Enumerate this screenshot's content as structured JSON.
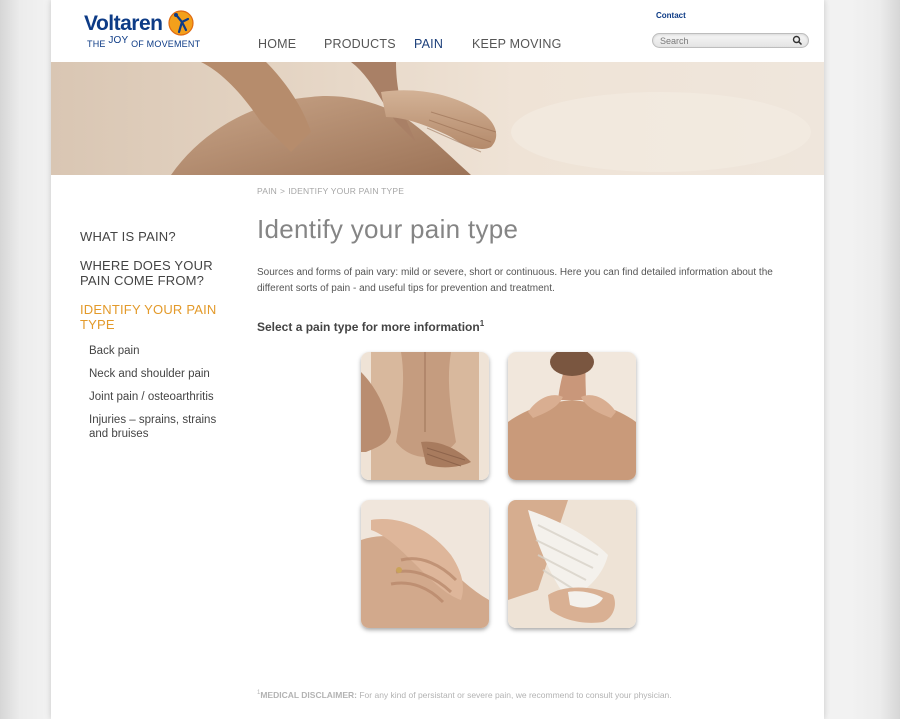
{
  "header": {
    "logo_text": "Voltaren",
    "logo_tagline_the": "THE",
    "logo_tagline_joy": "JOY",
    "logo_tagline_rest": "OF MOVEMENT",
    "contact_label": "Contact",
    "search_placeholder": "Search",
    "brand_color": "#0d3b86",
    "accent_color": "#e39a2a"
  },
  "nav": {
    "items": [
      {
        "label": "HOME",
        "active": false
      },
      {
        "label": "PRODUCTS",
        "active": false
      },
      {
        "label": "PAIN",
        "active": true
      },
      {
        "label": "KEEP MOVING",
        "active": false
      }
    ]
  },
  "breadcrumb": {
    "items": [
      "PAIN",
      "IDENTIFY YOUR PAIN TYPE"
    ],
    "separator": ">"
  },
  "sidebar": {
    "top_items": [
      {
        "label": "WHAT IS PAIN?",
        "active": false
      },
      {
        "label": "WHERE DOES YOUR PAIN COME FROM?",
        "active": false
      },
      {
        "label": "IDENTIFY YOUR PAIN TYPE",
        "active": true
      }
    ],
    "sub_items": [
      {
        "label": "Back pain"
      },
      {
        "label": "Neck and shoulder pain"
      },
      {
        "label": "Joint pain / osteoarthritis"
      },
      {
        "label": "Injuries – sprains, strains and bruises"
      }
    ]
  },
  "main": {
    "title": "Identify your pain type",
    "intro": "Sources and forms of pain vary: mild or severe, short or continuous. Here you can find detailed information about the different sorts of pain - and useful tips for prevention and treatment.",
    "select_title": "Select a pain type for more information",
    "select_footnote_marker": "1",
    "tiles": [
      {
        "icon": "back-pain-photo"
      },
      {
        "icon": "neck-shoulder-pain-photo"
      },
      {
        "icon": "joint-pain-hands-photo"
      },
      {
        "icon": "injury-bandage-photo"
      }
    ]
  },
  "footer": {
    "disclaimer_marker": "1",
    "disclaimer_label": "MEDICAL DISCLAIMER:",
    "disclaimer_text": " For any kind of persistant or severe pain, we recommend to consult your physician."
  }
}
